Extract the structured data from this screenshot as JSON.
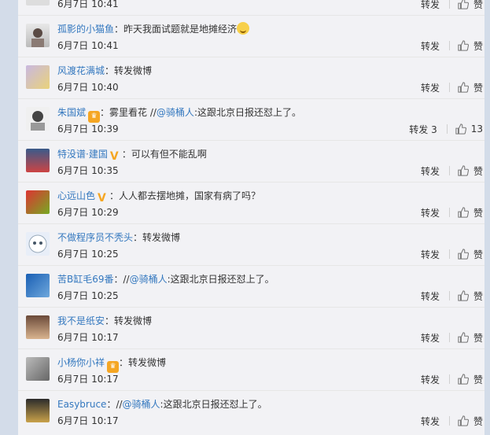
{
  "comments": [
    {
      "name": "",
      "text": "",
      "time": "6月7日 10:41",
      "repost": "转发",
      "like": "赞"
    },
    {
      "name": "孤影的小猫鱼",
      "text": "：昨天我面试题就是地摊经济",
      "time": "6月7日 10:41",
      "repost": "转发",
      "like": "赞"
    },
    {
      "name": "风渡花满城",
      "text": "：转发微博",
      "time": "6月7日 10:40",
      "repost": "转发",
      "like": "赞"
    },
    {
      "name": "朱国斌",
      "text": "：雾里看花 //",
      "mention": "@骑桶人",
      "text2": ":这跟北京日报还怼上了。",
      "time": "6月7日 10:39",
      "repost": "转发 3",
      "like": "13"
    },
    {
      "name": "特没谱·建国",
      "text": "：可以有但不能乱啊",
      "time": "6月7日 10:35",
      "repost": "转发",
      "like": "赞"
    },
    {
      "name": "心远山色",
      "text": "：人人都去摆地摊，国家有病了吗？",
      "time": "6月7日 10:29",
      "repost": "转发",
      "like": "赞"
    },
    {
      "name": "不做程序员不秃头",
      "text": "：转发微博",
      "time": "6月7日 10:25",
      "repost": "转发",
      "like": "赞"
    },
    {
      "name": "苦B缸毛69番",
      "text": "：//",
      "mention": "@骑桶人",
      "text2": ":这跟北京日报还怼上了。",
      "time": "6月7日 10:25",
      "repost": "转发",
      "like": "赞"
    },
    {
      "name": "我不是纸安",
      "text": "：转发微博",
      "time": "6月7日 10:17",
      "repost": "转发",
      "like": "赞"
    },
    {
      "name": "小杨你小祥",
      "text": "：转发微博",
      "time": "6月7日 10:17",
      "repost": "转发",
      "like": "赞"
    },
    {
      "name": "Easybruce",
      "text": "：//",
      "mention": "@骑桶人",
      "text2": ":这跟北京日报还怼上了。",
      "time": "6月7日 10:17",
      "repost": "转发",
      "like": "赞"
    }
  ],
  "colors": {
    "page_bg": "#d3dce9",
    "panel_bg": "#f2f2f5",
    "name": "#3478bf",
    "mention": "#eb7350",
    "badge": "#f5a623"
  }
}
